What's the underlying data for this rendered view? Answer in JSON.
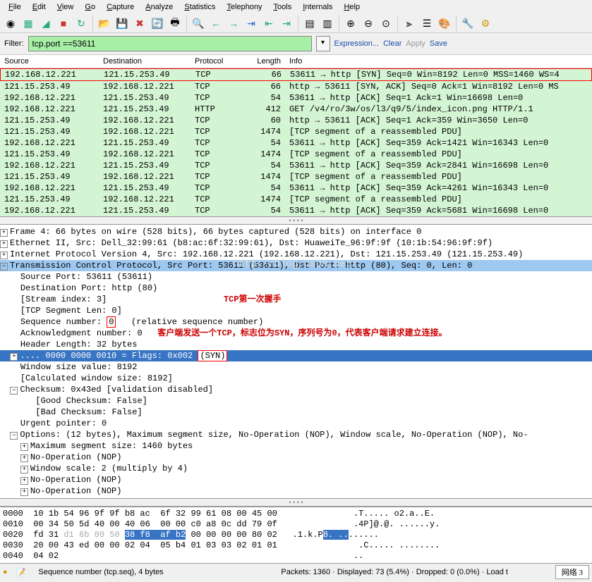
{
  "menu": [
    "File",
    "Edit",
    "View",
    "Go",
    "Capture",
    "Analyze",
    "Statistics",
    "Telephony",
    "Tools",
    "Internals",
    "Help"
  ],
  "filter": {
    "label": "Filter:",
    "value": "tcp.port ==53611",
    "expr": "Expression...",
    "clear": "Clear",
    "apply": "Apply",
    "save": "Save"
  },
  "headers": {
    "src": "Source",
    "dst": "Destination",
    "proto": "Protocol",
    "len": "Length",
    "info": "Info"
  },
  "packets": [
    {
      "src": "192.168.12.221",
      "dst": "121.15.253.49",
      "proto": "TCP",
      "len": "66",
      "info": "53611 → http [SYN] Seq=0 Win=8192 Len=0 MSS=1460 WS=4",
      "sel": true
    },
    {
      "src": "121.15.253.49",
      "dst": "192.168.12.221",
      "proto": "TCP",
      "len": "66",
      "info": "http → 53611 [SYN, ACK] Seq=0 Ack=1 Win=8192 Len=0 MS"
    },
    {
      "src": "192.168.12.221",
      "dst": "121.15.253.49",
      "proto": "TCP",
      "len": "54",
      "info": "53611 → http [ACK] Seq=1 Ack=1 Win=16698 Len=0"
    },
    {
      "src": "192.168.12.221",
      "dst": "121.15.253.49",
      "proto": "HTTP",
      "len": "412",
      "info": "GET /v4/ro/3w/os/l3/q9/5/index_icon.png HTTP/1.1"
    },
    {
      "src": "121.15.253.49",
      "dst": "192.168.12.221",
      "proto": "TCP",
      "len": "60",
      "info": "http → 53611 [ACK] Seq=1 Ack=359 Win=3650 Len=0"
    },
    {
      "src": "121.15.253.49",
      "dst": "192.168.12.221",
      "proto": "TCP",
      "len": "1474",
      "info": "[TCP segment of a reassembled PDU]"
    },
    {
      "src": "192.168.12.221",
      "dst": "121.15.253.49",
      "proto": "TCP",
      "len": "54",
      "info": "53611 → http [ACK] Seq=359 Ack=1421 Win=16343 Len=0"
    },
    {
      "src": "121.15.253.49",
      "dst": "192.168.12.221",
      "proto": "TCP",
      "len": "1474",
      "info": "[TCP segment of a reassembled PDU]"
    },
    {
      "src": "192.168.12.221",
      "dst": "121.15.253.49",
      "proto": "TCP",
      "len": "54",
      "info": "53611 → http [ACK] Seq=359 Ack=2841 Win=16698 Len=0"
    },
    {
      "src": "121.15.253.49",
      "dst": "192.168.12.221",
      "proto": "TCP",
      "len": "1474",
      "info": "[TCP segment of a reassembled PDU]"
    },
    {
      "src": "192.168.12.221",
      "dst": "121.15.253.49",
      "proto": "TCP",
      "len": "54",
      "info": "53611 → http [ACK] Seq=359 Ack=4261 Win=16343 Len=0"
    },
    {
      "src": "121.15.253.49",
      "dst": "192.168.12.221",
      "proto": "TCP",
      "len": "1474",
      "info": "[TCP segment of a reassembled PDU]"
    },
    {
      "src": "192.168.12.221",
      "dst": "121.15.253.49",
      "proto": "TCP",
      "len": "54",
      "info": "53611 → http [ACK] Seq=359 Ack=5681 Win=16698 Len=0"
    }
  ],
  "det": {
    "frame": "Frame 4: 66 bytes on wire (528 bits), 66 bytes captured (528 bits) on interface 0",
    "eth": "Ethernet II, Src: Dell_32:99:61 (b8:ac:6f:32:99:61), Dst: HuaweiTe_96:9f:9f (10:1b:54:96:9f:9f)",
    "ip": "Internet Protocol Version 4, Src: 192.168.12.221 (192.168.12.221), Dst: 121.15.253.49 (121.15.253.49)",
    "tcp": "Transmission Control Protocol, Src Port: 53611 (53611), Dst Port: http (80), Seq: 0, Len: 0",
    "srcport": "Source Port: 53611 (53611)",
    "dstport": "Destination Port: http (80)",
    "stream": "[Stream index: 3]",
    "seglen": "[TCP Segment Len: 0]",
    "seqlbl": "Sequence number: ",
    "seqval": "0",
    "seqrel": "   (relative sequence number)",
    "ack": "Acknowledgment number: 0",
    "hdrlen": "Header Length: 32 bytes",
    "flags_pre": ".... 0000 0000 0010 = Flags: 0x002 ",
    "flags_syn": "(SYN)",
    "win": "Window size value: 8192",
    "calcwin": "[Calculated window size: 8192]",
    "chksum": "Checksum: 0x43ed [validation disabled]",
    "goodck": "[Good Checksum: False]",
    "badck": "[Bad Checksum: False]",
    "urg": "Urgent pointer: 0",
    "opts": "Options: (12 bytes), Maximum segment size, No-Operation (NOP), Window scale, No-Operation (NOP), No-",
    "mss": "Maximum segment size: 1460 bytes",
    "nop": "No-Operation (NOP)",
    "wscale": "Window scale: 2 (multiply by 4)"
  },
  "anno": {
    "title": "TCP第一次握手",
    "note": "客户端发送一个TCP，标志位为SYN，序列号为0，代表客户端请求建立连接。"
  },
  "watermark": "http://blog.csdn.net/",
  "hex": [
    {
      "off": "0000",
      "b": "10 1b 54 96 9f 9f b8 ac  6f 32 99 61 08 00 45 00",
      "a": ".T..... o2.a..E."
    },
    {
      "off": "0010",
      "b": "00 34 50 5d 40 00 40 06  00 00 c0 a8 0c dd 79 0f",
      "a": ".4P]@.@. ......y."
    },
    {
      "off": "0020",
      "b": "fd 31 ",
      "dim": "d1 6b 00 50 ",
      "hl": "38 f8  af b2",
      "b2": " 00 00 00 00 80 02",
      "a": ".1.k.P",
      "ahl": "8. ..",
      "a2": "......"
    },
    {
      "off": "0030",
      "b": "20 00 43 ed 00 00 02 04  05 b4 01 03 03 02 01 01",
      "a": " .C..... ........"
    },
    {
      "off": "0040",
      "b": "04 02",
      "a": ".."
    }
  ],
  "status": {
    "field": "Sequence number (tcp.seq), 4 bytes",
    "stats": "Packets: 1360 · Displayed: 73 (5.4%) · Dropped: 0 (0.0%) · Load t",
    "tab": "网络 3"
  }
}
